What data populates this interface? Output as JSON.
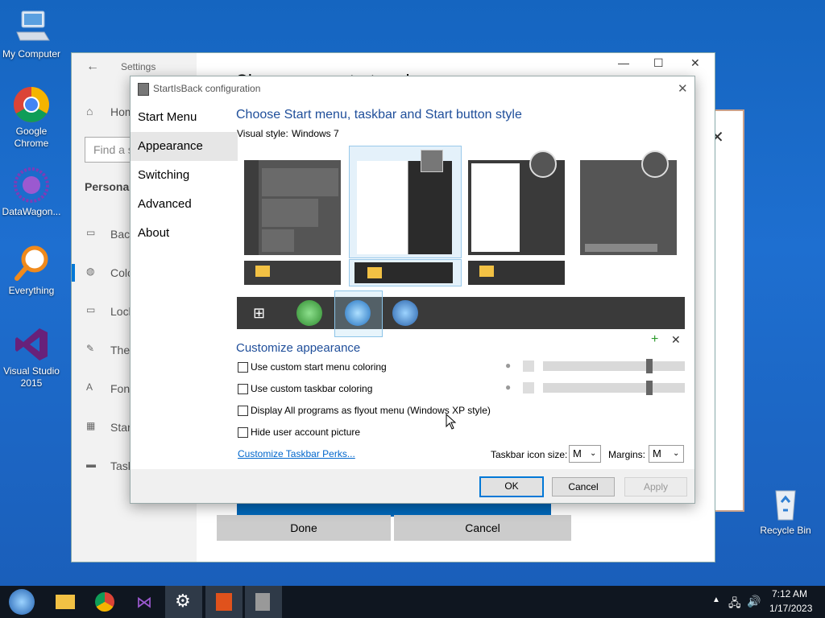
{
  "desktop": {
    "icons": [
      {
        "label": "My Computer"
      },
      {
        "label": "Google Chrome"
      },
      {
        "label": "DataWagon..."
      },
      {
        "label": "Everything"
      },
      {
        "label": "Visual Studio 2015"
      },
      {
        "label": "Recycle Bin"
      }
    ]
  },
  "settings": {
    "title": "Settings",
    "heading": "Choose your start and",
    "nav": [
      "Home",
      "Find a s",
      "Personali",
      "Back",
      "Colo",
      "Lock",
      "Ther",
      "Font",
      "Start",
      "Task"
    ],
    "done_label": "Done",
    "cancel_label": "Cancel"
  },
  "dialog": {
    "title": "StartIsBack configuration",
    "nav": [
      "Start Menu",
      "Appearance",
      "Switching",
      "Advanced",
      "About"
    ],
    "selected_nav": "Appearance",
    "heading": "Choose Start menu, taskbar and Start button style",
    "visual_style_label": "Visual style:",
    "visual_style_value": "Windows 7",
    "customize_heading": "Customize appearance",
    "options": [
      "Use custom start menu coloring",
      "Use custom taskbar coloring",
      "Display All programs as flyout menu (Windows XP style)",
      "Hide user account picture"
    ],
    "perks_link": "Customize Taskbar Perks...",
    "icon_size_label": "Taskbar icon size:",
    "icon_size_value": "M",
    "margins_label": "Margins:",
    "margins_value": "M",
    "ok_label": "OK",
    "cancel_label": "Cancel",
    "apply_label": "Apply",
    "colors": {
      "accent": "#1f4e9a",
      "link": "#0066cc"
    }
  },
  "taskbar": {
    "time": "7:12 AM",
    "date": "1/17/2023"
  }
}
